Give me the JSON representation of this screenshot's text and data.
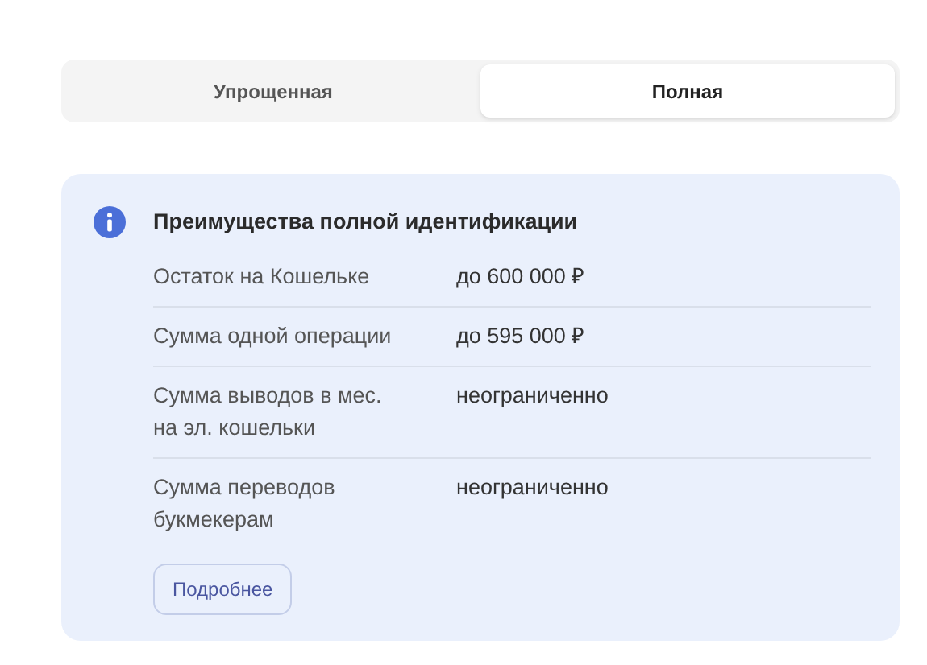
{
  "tabs": [
    {
      "label": "Упрощенная",
      "selected": false
    },
    {
      "label": "Полная",
      "selected": true
    }
  ],
  "info_card": {
    "title": "Преимущества полной идентификации",
    "rows": [
      {
        "label": "Остаток на Кошельке",
        "value": "до 600 000 ₽"
      },
      {
        "label": "Сумма одной операции",
        "value": "до 595 000 ₽"
      },
      {
        "label": "Сумма выводов в мес.\nна эл. кошельки",
        "value": "неограниченно"
      },
      {
        "label": "Сумма переводов\nбукмекерам",
        "value": "неограниченно"
      }
    ],
    "button": "Подробнее"
  }
}
